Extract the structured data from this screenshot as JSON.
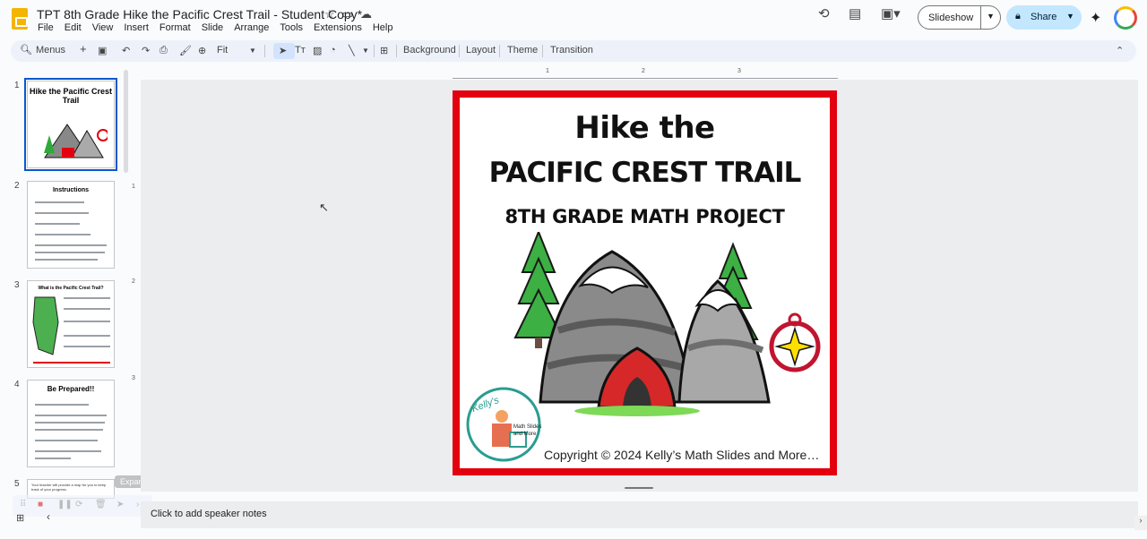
{
  "doc": {
    "title": "TPT 8th Grade Hike the Pacific Crest Trail - Student Copy*"
  },
  "menu": [
    "File",
    "Edit",
    "View",
    "Insert",
    "Format",
    "Slide",
    "Arrange",
    "Tools",
    "Extensions",
    "Help"
  ],
  "header": {
    "slideshow_label": "Slideshow",
    "share_label": "Share"
  },
  "toolbar": {
    "search_label": "Menus",
    "zoom_value": "Fit",
    "background_label": "Background",
    "layout_label": "Layout",
    "theme_label": "Theme",
    "transition_label": "Transition"
  },
  "ruler": {
    "h_ticks": [
      "1",
      "2",
      "3"
    ],
    "v_ticks": [
      "1",
      "2",
      "3"
    ]
  },
  "slides": [
    {
      "number": "1",
      "title": "Hike the Pacific Crest Trail"
    },
    {
      "number": "2",
      "title": "Instructions"
    },
    {
      "number": "3",
      "title": "What is the Pacific Crest Trail?"
    },
    {
      "number": "4",
      "title": "Be Prepared!!"
    },
    {
      "number": "5",
      "title": "Your teacher will provide a map for you to keep track of your progress."
    }
  ],
  "slide": {
    "title_line1": "Hike the",
    "title_line2": "PACIFIC CREST TRAIL",
    "subtitle": "8TH GRADE MATH PROJECT",
    "logo_text": "Kelly's",
    "logo_sub": "Math Slides and More",
    "copyright": "Copyright © 2024 Kelly’s Math Slides and More…"
  },
  "notes": {
    "placeholder": "Click to add speaker notes"
  },
  "tooltip": {
    "expand": "Expand (Alt+H)"
  },
  "colors": {
    "slide_border": "#e3000f",
    "share_bg": "#c2e7ff",
    "selected_thumb": "#0b57d0",
    "app_logo": "#f4b400"
  }
}
